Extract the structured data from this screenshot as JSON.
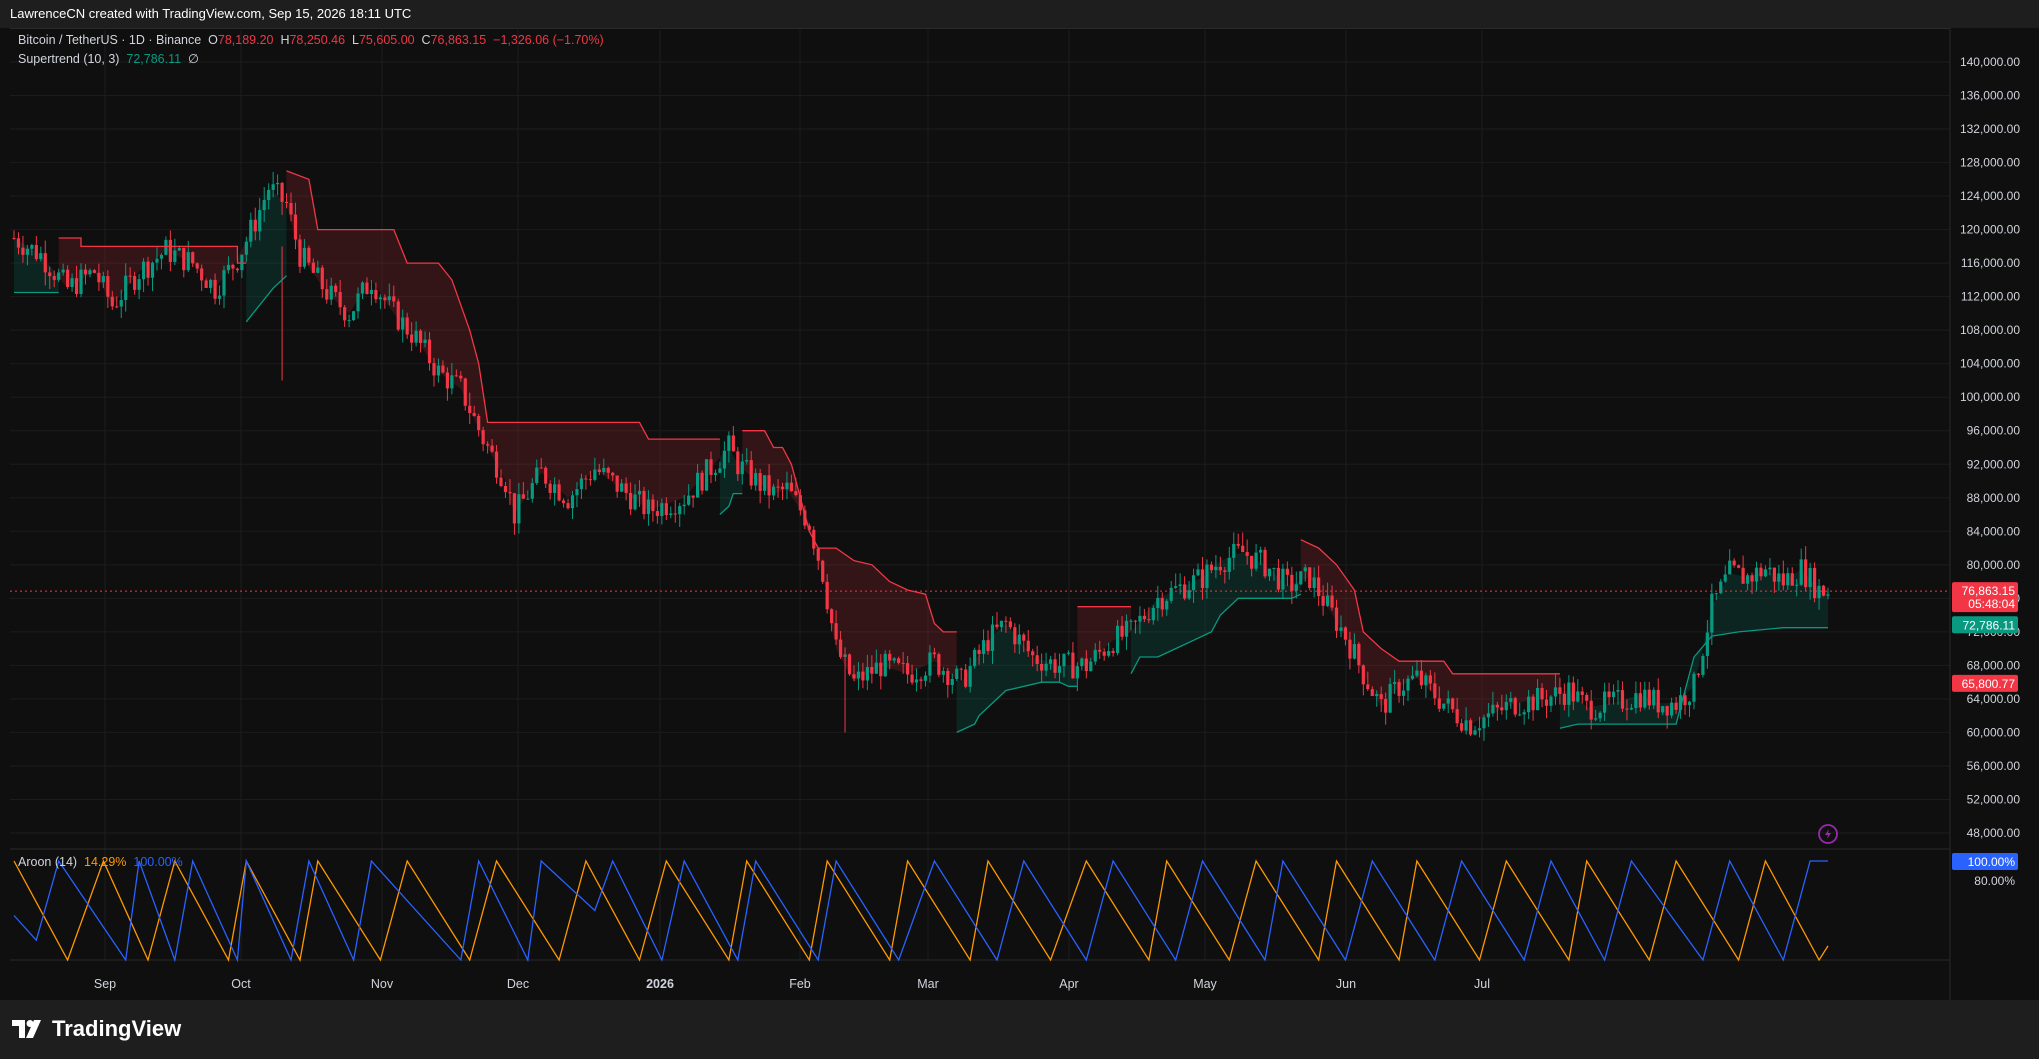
{
  "header": {
    "attribution": "LawrenceCN created with TradingView.com, Sep 15, 2026 18:11 UTC"
  },
  "legend": {
    "symbol": "Bitcoin / TetherUS · 1D · Binance",
    "open_label": "O",
    "open": "78,189.20",
    "high_label": "H",
    "high": "78,250.46",
    "low_label": "L",
    "low": "75,605.00",
    "close_label": "C",
    "close": "76,863.15",
    "change": "−1,326.06 (−1.70%)",
    "supertrend_label": "Supertrend (10, 3)",
    "supertrend_value": "72,786.11",
    "supertrend_extra": "∅",
    "aroon_label": "Aroon (14)",
    "aroon_down": "14.29%",
    "aroon_up": "100.00%"
  },
  "price_axis": {
    "ticks": [
      "140,000.00",
      "136,000.00",
      "132,000.00",
      "128,000.00",
      "124,000.00",
      "120,000.00",
      "116,000.00",
      "112,000.00",
      "108,000.00",
      "104,000.00",
      "100,000.00",
      "96,000.00",
      "92,000.00",
      "88,000.00",
      "84,000.00",
      "80,000.00",
      "76,000.00",
      "72,000.00",
      "68,000.00",
      "64,000.00",
      "60,000.00",
      "56,000.00",
      "52,000.00",
      "48,000.00"
    ],
    "last_price": "76,863.15",
    "countdown": "05:48:04",
    "supertrend_tag": "72,786.11",
    "level_tag": "65,800.77",
    "aroon_tag": "100.00%",
    "aroon_tick": "80.00%"
  },
  "time_axis": {
    "labels": [
      "Sep",
      "Oct",
      "Nov",
      "Dec",
      "2026",
      "Feb",
      "Mar",
      "Apr",
      "May",
      "Jun",
      "Jul"
    ]
  },
  "brand": {
    "name": "TradingView"
  },
  "colors": {
    "up": "#089981",
    "down": "#f23645",
    "aroon_up": "#2962ff",
    "aroon_down": "#ff9800",
    "background": "#0f0f0f"
  },
  "chart_data": {
    "type": "candlestick",
    "title": "Bitcoin / TetherUS · 1D · Binance",
    "ylim": [
      44000,
      143500
    ],
    "x_labels": [
      "Sep",
      "Oct",
      "Nov",
      "Dec",
      "2026",
      "Feb",
      "Mar",
      "Apr",
      "May",
      "Jun",
      "Jul"
    ],
    "close_path": [
      [
        0,
        119000
      ],
      [
        6,
        117000
      ],
      [
        12,
        113000
      ],
      [
        18,
        115000
      ],
      [
        22,
        111000
      ],
      [
        28,
        115000
      ],
      [
        34,
        117500
      ],
      [
        40,
        116000
      ],
      [
        45,
        113000
      ],
      [
        50,
        116500
      ],
      [
        54,
        121000
      ],
      [
        57,
        125000
      ],
      [
        61,
        123000
      ],
      [
        64,
        117000
      ],
      [
        70,
        112500
      ],
      [
        75,
        110000
      ],
      [
        80,
        114000
      ],
      [
        85,
        110000
      ],
      [
        90,
        107000
      ],
      [
        95,
        103000
      ],
      [
        100,
        101000
      ],
      [
        105,
        95000
      ],
      [
        110,
        90000
      ],
      [
        112,
        86000
      ],
      [
        118,
        91000
      ],
      [
        124,
        88000
      ],
      [
        130,
        91500
      ],
      [
        136,
        89000
      ],
      [
        142,
        86500
      ],
      [
        150,
        88000
      ],
      [
        155,
        91000
      ],
      [
        160,
        94000
      ],
      [
        162,
        92000
      ],
      [
        166,
        90000
      ],
      [
        170,
        88500
      ],
      [
        173,
        89000
      ],
      [
        178,
        85000
      ],
      [
        181,
        79000
      ],
      [
        184,
        70000
      ],
      [
        188,
        66000
      ],
      [
        194,
        68000
      ],
      [
        200,
        67000
      ],
      [
        206,
        68500
      ],
      [
        212,
        66000
      ],
      [
        218,
        71000
      ],
      [
        222,
        73000
      ],
      [
        228,
        69000
      ],
      [
        234,
        68000
      ],
      [
        240,
        68000
      ],
      [
        246,
        71000
      ],
      [
        250,
        72000
      ],
      [
        256,
        76000
      ],
      [
        260,
        77000
      ],
      [
        266,
        78500
      ],
      [
        270,
        80500
      ],
      [
        275,
        81500
      ],
      [
        280,
        80000
      ],
      [
        285,
        77500
      ],
      [
        290,
        78500
      ],
      [
        294,
        75000
      ],
      [
        298,
        71500
      ],
      [
        302,
        67000
      ],
      [
        306,
        63000
      ],
      [
        310,
        65500
      ],
      [
        314,
        66500
      ],
      [
        318,
        64500
      ],
      [
        322,
        62500
      ],
      [
        326,
        61000
      ],
      [
        330,
        62000
      ],
      [
        336,
        63500
      ],
      [
        342,
        64000
      ],
      [
        348,
        65000
      ],
      [
        352,
        63000
      ],
      [
        358,
        63500
      ],
      [
        364,
        64500
      ],
      [
        368,
        63500
      ],
      [
        372,
        63500
      ],
      [
        376,
        65500
      ],
      [
        380,
        75000
      ],
      [
        384,
        79000
      ],
      [
        388,
        78500
      ],
      [
        392,
        79500
      ],
      [
        396,
        78000
      ],
      [
        400,
        79500
      ],
      [
        404,
        77000
      ],
      [
        406,
        76863
      ]
    ],
    "supertrend_segments": [
      {
        "trend": "up",
        "points": [
          [
            0,
            112500
          ],
          [
            10,
            112500
          ]
        ]
      },
      {
        "trend": "down",
        "points": [
          [
            10,
            119000
          ],
          [
            15,
            119000
          ],
          [
            15,
            118000
          ],
          [
            50,
            118000
          ],
          [
            50,
            116000
          ],
          [
            52,
            116000
          ]
        ]
      },
      {
        "trend": "up",
        "points": [
          [
            52,
            109000
          ],
          [
            55,
            111000
          ],
          [
            58,
            113000
          ],
          [
            60,
            114000
          ],
          [
            61,
            114500
          ]
        ]
      },
      {
        "trend": "down",
        "points": [
          [
            61,
            127000
          ],
          [
            66,
            126000
          ],
          [
            68,
            120000
          ],
          [
            85,
            120000
          ],
          [
            88,
            116000
          ],
          [
            95,
            116000
          ],
          [
            98,
            114000
          ],
          [
            102,
            108000
          ],
          [
            104,
            104000
          ],
          [
            106,
            97000
          ],
          [
            140,
            97000
          ],
          [
            142,
            95000
          ],
          [
            158,
            95000
          ]
        ]
      },
      {
        "trend": "up",
        "points": [
          [
            158,
            86000
          ],
          [
            160,
            87000
          ],
          [
            161,
            88500
          ],
          [
            163,
            88500
          ]
        ]
      },
      {
        "trend": "down",
        "points": [
          [
            163,
            96000
          ],
          [
            168,
            96000
          ],
          [
            170,
            94000
          ],
          [
            172,
            94000
          ],
          [
            174,
            92000
          ],
          [
            176,
            88000
          ],
          [
            178,
            84000
          ],
          [
            180,
            82000
          ],
          [
            184,
            82000
          ],
          [
            188,
            80500
          ],
          [
            192,
            80000
          ],
          [
            196,
            78000
          ],
          [
            200,
            77000
          ],
          [
            204,
            76500
          ],
          [
            206,
            73000
          ],
          [
            208,
            72000
          ],
          [
            211,
            72000
          ]
        ]
      },
      {
        "trend": "up",
        "points": [
          [
            211,
            60000
          ],
          [
            215,
            61000
          ],
          [
            216,
            62000
          ],
          [
            220,
            64000
          ],
          [
            222,
            65000
          ],
          [
            230,
            66000
          ],
          [
            234,
            66000
          ],
          [
            236,
            65500
          ],
          [
            238,
            65500
          ]
        ]
      },
      {
        "trend": "down",
        "points": [
          [
            238,
            75000
          ],
          [
            250,
            75000
          ]
        ]
      },
      {
        "trend": "up",
        "points": [
          [
            250,
            67000
          ],
          [
            252,
            69000
          ],
          [
            256,
            69000
          ],
          [
            260,
            70000
          ],
          [
            264,
            71000
          ],
          [
            268,
            72000
          ],
          [
            270,
            74000
          ],
          [
            274,
            76000
          ],
          [
            280,
            76000
          ],
          [
            286,
            76000
          ],
          [
            288,
            76500
          ]
        ]
      },
      {
        "trend": "down",
        "points": [
          [
            288,
            83000
          ],
          [
            292,
            82000
          ],
          [
            296,
            80000
          ],
          [
            300,
            77000
          ],
          [
            302,
            72000
          ],
          [
            306,
            70000
          ],
          [
            310,
            68500
          ],
          [
            320,
            68500
          ],
          [
            322,
            67000
          ],
          [
            338,
            67000
          ],
          [
            346,
            67000
          ]
        ]
      },
      {
        "trend": "up",
        "points": [
          [
            346,
            60500
          ],
          [
            350,
            61000
          ],
          [
            370,
            61000
          ],
          [
            372,
            61000
          ],
          [
            374,
            65000
          ],
          [
            376,
            69000
          ],
          [
            380,
            71500
          ],
          [
            386,
            72000
          ],
          [
            396,
            72500
          ],
          [
            406,
            72500
          ]
        ]
      }
    ],
    "aroon_up_path": [
      [
        0,
        45
      ],
      [
        5,
        20
      ],
      [
        10,
        100
      ],
      [
        25,
        0
      ],
      [
        28,
        100
      ],
      [
        36,
        0
      ],
      [
        40,
        100
      ],
      [
        50,
        0
      ],
      [
        52,
        100
      ],
      [
        62,
        0
      ],
      [
        66,
        100
      ],
      [
        76,
        0
      ],
      [
        80,
        100
      ],
      [
        100,
        0
      ],
      [
        104,
        100
      ],
      [
        115,
        0
      ],
      [
        118,
        100
      ],
      [
        130,
        50
      ],
      [
        134,
        100
      ],
      [
        145,
        0
      ],
      [
        150,
        100
      ],
      [
        162,
        0
      ],
      [
        166,
        100
      ],
      [
        180,
        0
      ],
      [
        184,
        100
      ],
      [
        198,
        0
      ],
      [
        206,
        100
      ],
      [
        220,
        0
      ],
      [
        226,
        100
      ],
      [
        240,
        0
      ],
      [
        246,
        100
      ],
      [
        260,
        0
      ],
      [
        266,
        100
      ],
      [
        280,
        0
      ],
      [
        284,
        100
      ],
      [
        298,
        0
      ],
      [
        304,
        100
      ],
      [
        318,
        0
      ],
      [
        324,
        100
      ],
      [
        338,
        0
      ],
      [
        344,
        100
      ],
      [
        356,
        0
      ],
      [
        362,
        100
      ],
      [
        378,
        0
      ],
      [
        384,
        100
      ],
      [
        396,
        0
      ],
      [
        402,
        100
      ],
      [
        406,
        100
      ]
    ],
    "aroon_down_path": [
      [
        0,
        100
      ],
      [
        12,
        0
      ],
      [
        20,
        100
      ],
      [
        30,
        0
      ],
      [
        36,
        100
      ],
      [
        48,
        0
      ],
      [
        52,
        100
      ],
      [
        64,
        0
      ],
      [
        68,
        100
      ],
      [
        82,
        0
      ],
      [
        88,
        100
      ],
      [
        102,
        0
      ],
      [
        108,
        100
      ],
      [
        122,
        0
      ],
      [
        128,
        100
      ],
      [
        140,
        0
      ],
      [
        146,
        100
      ],
      [
        160,
        0
      ],
      [
        164,
        100
      ],
      [
        178,
        0
      ],
      [
        182,
        100
      ],
      [
        196,
        0
      ],
      [
        200,
        100
      ],
      [
        214,
        0
      ],
      [
        218,
        100
      ],
      [
        232,
        0
      ],
      [
        240,
        100
      ],
      [
        254,
        0
      ],
      [
        258,
        100
      ],
      [
        272,
        0
      ],
      [
        278,
        100
      ],
      [
        292,
        0
      ],
      [
        296,
        100
      ],
      [
        310,
        0
      ],
      [
        314,
        100
      ],
      [
        328,
        0
      ],
      [
        334,
        100
      ],
      [
        348,
        0
      ],
      [
        352,
        100
      ],
      [
        366,
        0
      ],
      [
        372,
        100
      ],
      [
        386,
        0
      ],
      [
        392,
        100
      ],
      [
        404,
        0
      ],
      [
        406,
        14.29
      ]
    ],
    "series": [
      {
        "name": "Supertrend (10, 3)",
        "last": 72786.11
      },
      {
        "name": "Aroon (14)",
        "up": 100.0,
        "down": 14.29
      }
    ]
  }
}
